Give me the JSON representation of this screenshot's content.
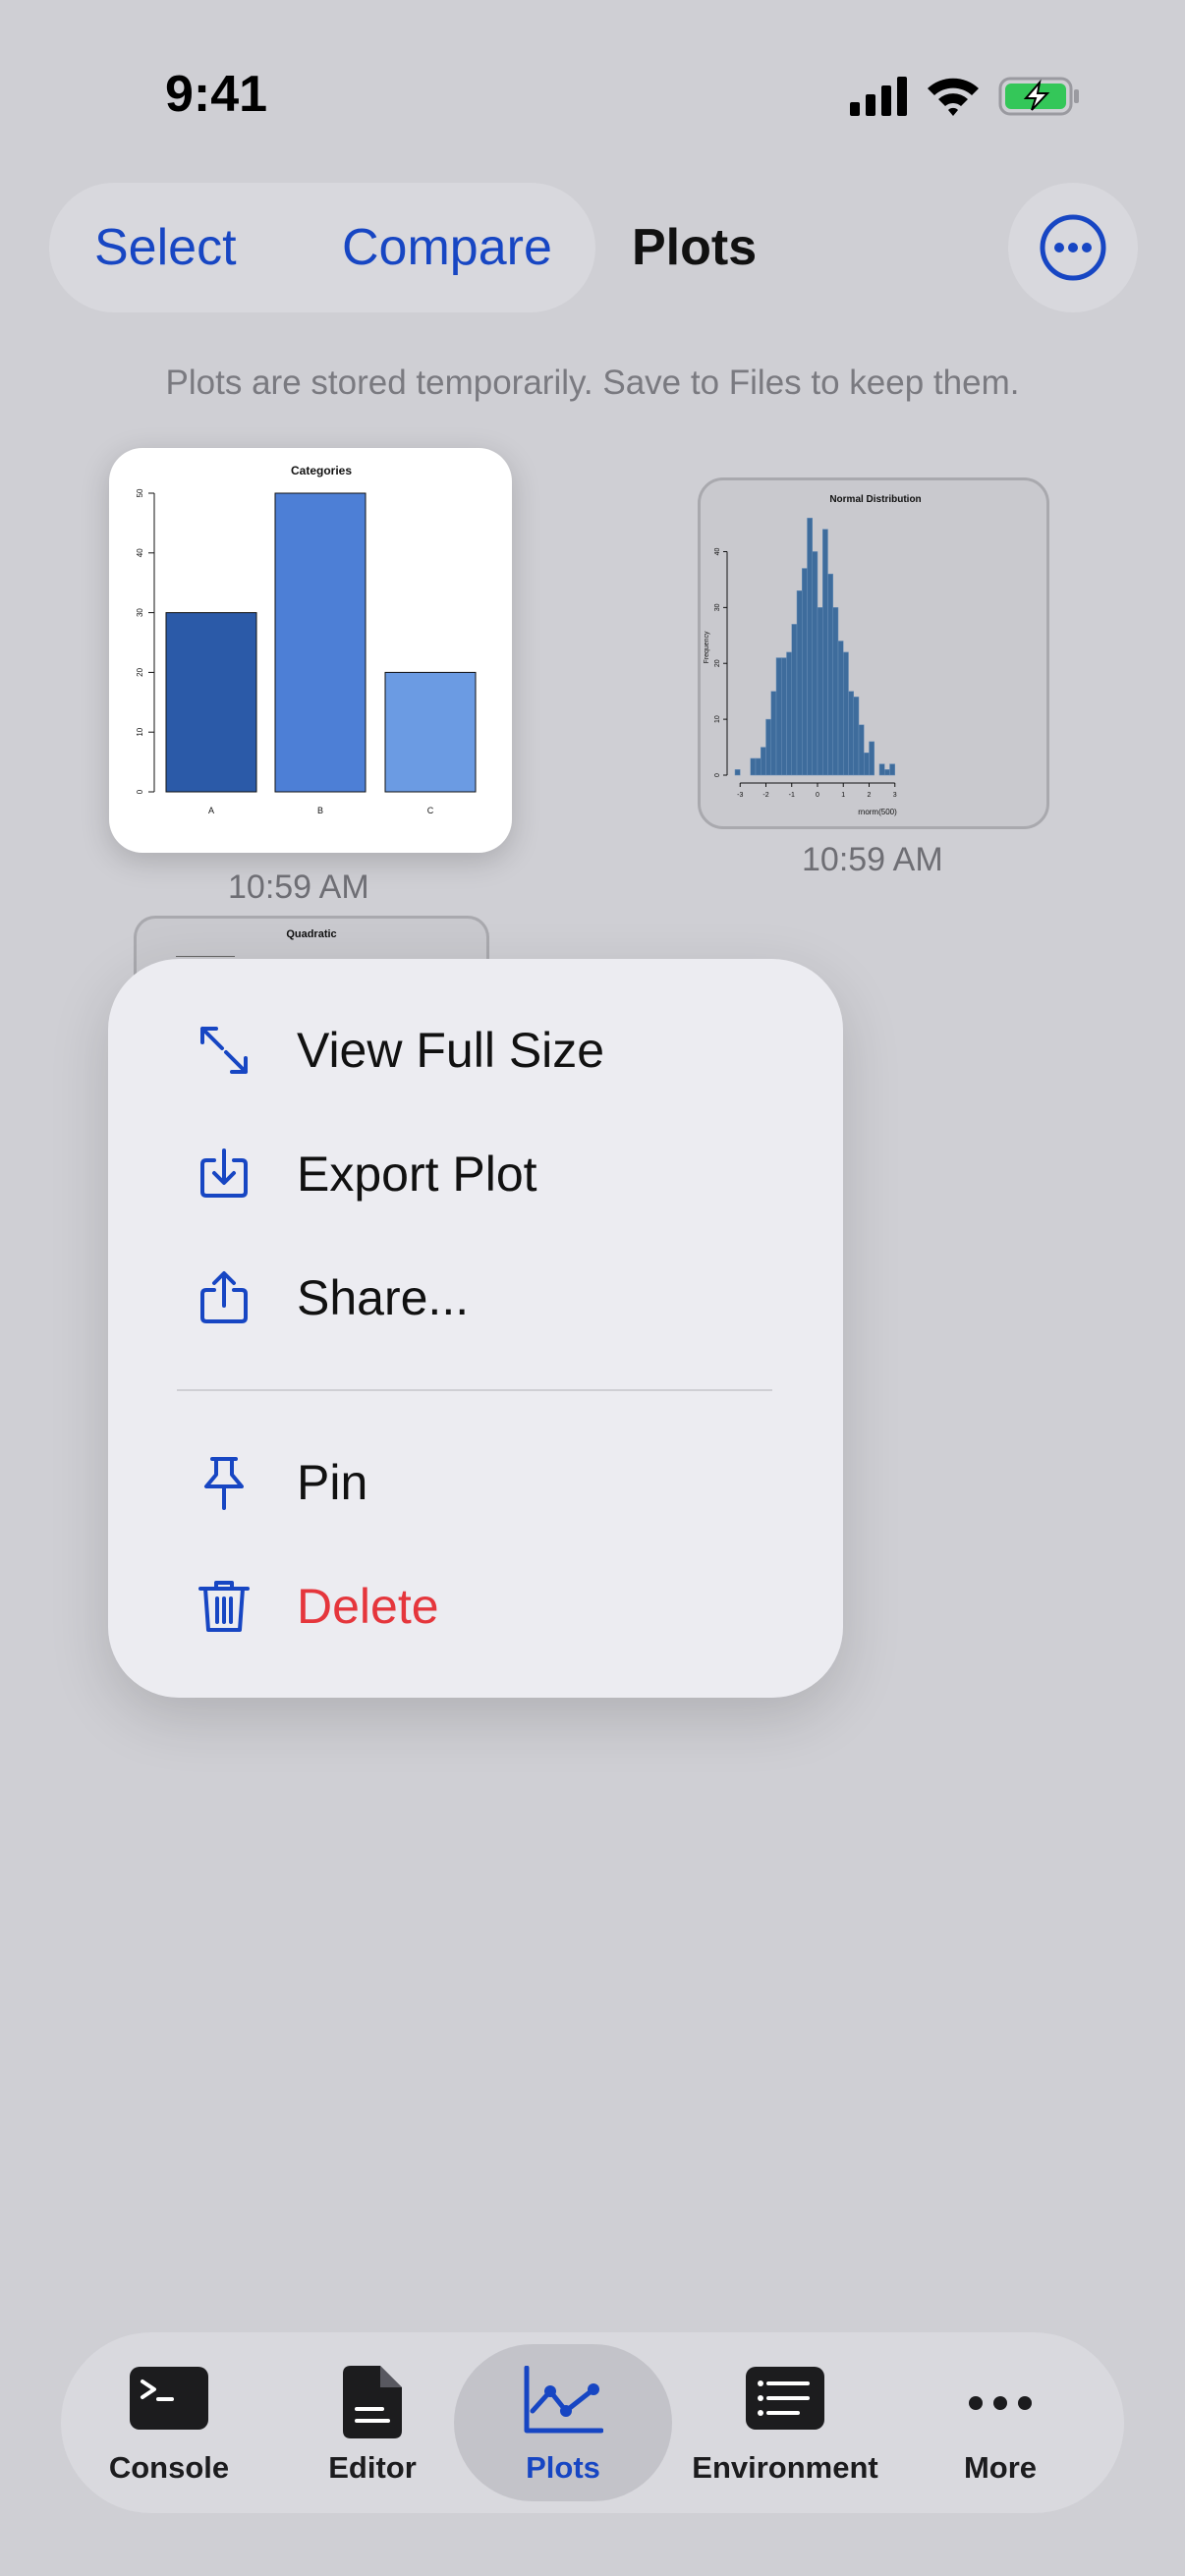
{
  "status": {
    "time": "9:41"
  },
  "toolbar": {
    "select_label": "Select",
    "compare_label": "Compare",
    "title": "Plots",
    "more_icon": "ellipsis-circle-icon"
  },
  "notice": "Plots are stored temporarily. Save to Files to keep them.",
  "plots": [
    {
      "time": "10:59 AM",
      "chart_data": {
        "type": "bar",
        "title": "Categories",
        "categories": [
          "A",
          "B",
          "C"
        ],
        "values": [
          30,
          50,
          20
        ],
        "ylim": [
          0,
          50
        ],
        "yticks": [
          "0",
          "10",
          "20",
          "30",
          "40",
          "50"
        ],
        "colors": [
          "#2b5aa8",
          "#4d7fd6",
          "#6b9be3"
        ]
      }
    },
    {
      "time": "10:59 AM",
      "chart_data": {
        "type": "bar",
        "title": "Normal Distribution",
        "xlabel": "rnorm(500)",
        "ylabel": "Frequency",
        "xticks": [
          "-3",
          "-2",
          "-1",
          "0",
          "1",
          "2",
          "3"
        ],
        "yticks": [
          "0",
          "10",
          "20",
          "30",
          "40"
        ],
        "ylim": [
          0,
          45
        ],
        "bin_start": -3.2,
        "bin_width": 0.2,
        "values": [
          1,
          0,
          0,
          3,
          3,
          5,
          10,
          15,
          21,
          21,
          22,
          27,
          33,
          37,
          46,
          40,
          30,
          44,
          36,
          30,
          24,
          22,
          15,
          14,
          9,
          4,
          6,
          0,
          2,
          1,
          2
        ],
        "color": "#3e6c9c"
      }
    },
    {
      "title": "Quadratic"
    }
  ],
  "menu": {
    "items": [
      {
        "label": "View Full Size",
        "icon": "expand-arrows-icon"
      },
      {
        "label": "Export Plot",
        "icon": "tray-arrow-down-icon"
      },
      {
        "label": "Share...",
        "icon": "share-icon"
      },
      {
        "label": "Pin",
        "icon": "pin-icon"
      },
      {
        "label": "Delete",
        "icon": "trash-icon",
        "color": "#e5363c"
      }
    ]
  },
  "tabs": [
    {
      "label": "Console",
      "icon": "terminal-icon"
    },
    {
      "label": "Editor",
      "icon": "document-icon"
    },
    {
      "label": "Plots",
      "icon": "chart-line-icon",
      "active": true
    },
    {
      "label": "Environment",
      "icon": "list-icon"
    },
    {
      "label": "More",
      "icon": "ellipsis-icon"
    }
  ],
  "colors": {
    "accent": "#1746c3",
    "destructive": "#e5363c",
    "background": "#cfcfd4"
  }
}
